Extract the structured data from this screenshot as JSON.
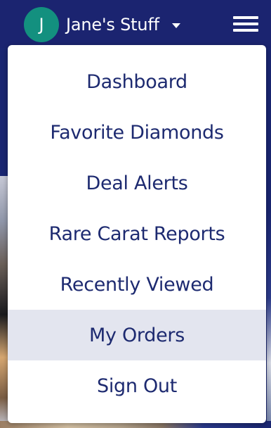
{
  "header": {
    "avatar_initial": "J",
    "user_name": "Jane's Stuff",
    "dropdown_icon": "caret-down-icon",
    "menu_icon": "hamburger-menu-icon"
  },
  "menu": {
    "items": [
      {
        "label": "Dashboard"
      },
      {
        "label": "Favorite Diamonds"
      },
      {
        "label": "Deal Alerts"
      },
      {
        "label": "Rare Carat Reports"
      },
      {
        "label": "Recently Viewed"
      },
      {
        "label": "My Orders",
        "active": true
      },
      {
        "label": "Sign Out"
      }
    ]
  },
  "colors": {
    "header_bg": "#1b2470",
    "avatar_bg": "#13907f",
    "menu_text": "#1d2a70",
    "active_item_bg": "#e3e5ef"
  }
}
